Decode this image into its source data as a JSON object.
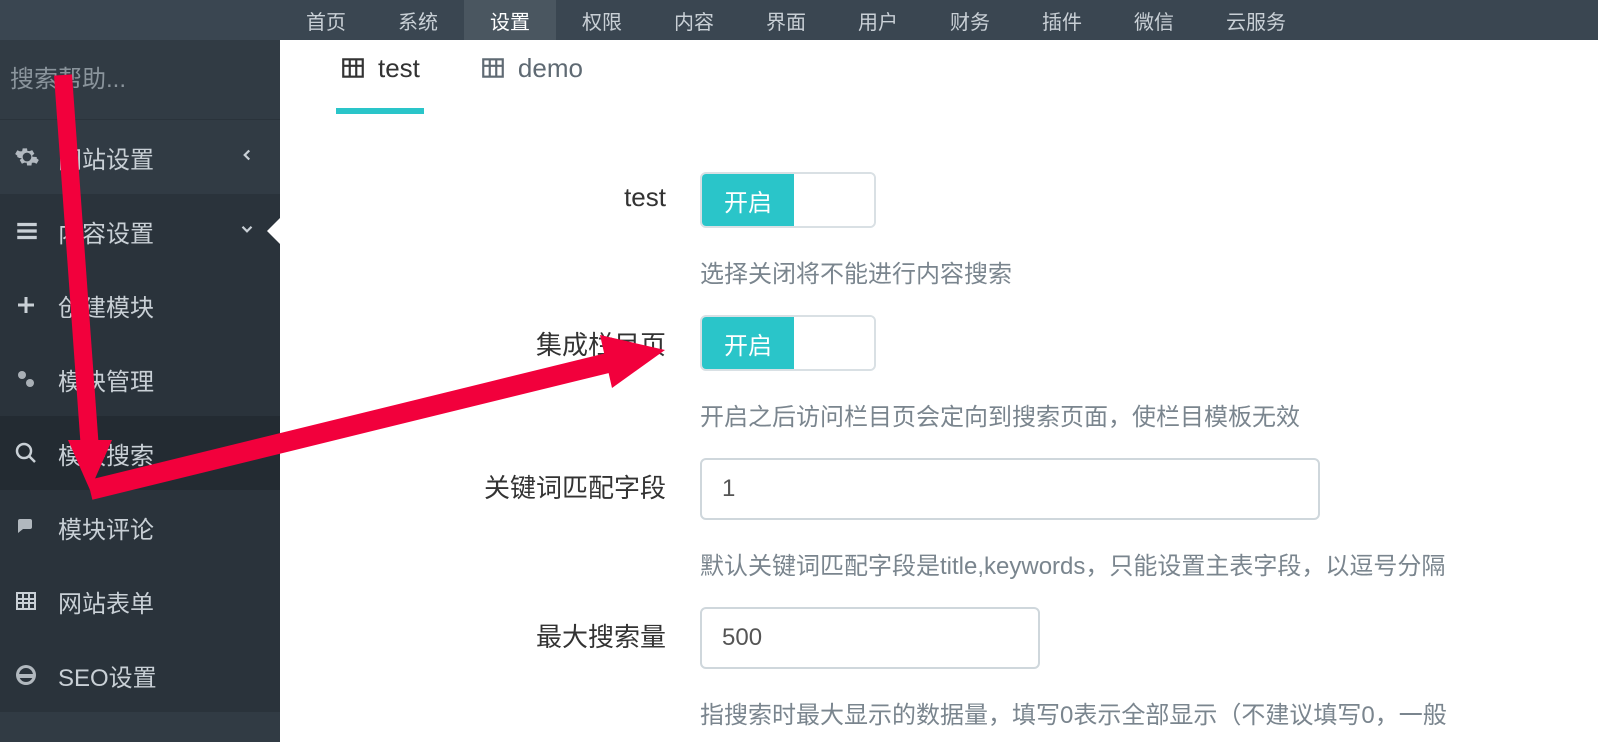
{
  "topnav": {
    "items": [
      "首页",
      "系统",
      "设置",
      "权限",
      "内容",
      "界面",
      "用户",
      "财务",
      "插件",
      "微信",
      "云服务"
    ],
    "activeIndex": 2
  },
  "sidebar": {
    "search_placeholder": "搜索帮助...",
    "items": [
      {
        "label": "网站设置"
      },
      {
        "label": "内容设置"
      }
    ],
    "subs": [
      {
        "label": "创建模块"
      },
      {
        "label": "模块管理"
      },
      {
        "label": "模块搜索"
      },
      {
        "label": "模块评论"
      },
      {
        "label": "网站表单"
      },
      {
        "label": "SEO设置"
      }
    ]
  },
  "tabs": {
    "items": [
      "test",
      "demo"
    ],
    "activeIndex": 0
  },
  "form": {
    "toggle_on_label": "开启",
    "row1": {
      "label": "test",
      "help": "选择关闭将不能进行内容搜索"
    },
    "row2": {
      "label": "集成栏目页",
      "help": "开启之后访问栏目页会定向到搜索页面，使栏目模板无效"
    },
    "row3": {
      "label": "关键词匹配字段",
      "value": "1",
      "help": "默认关键词匹配字段是title,keywords，只能设置主表字段，以逗号分隔"
    },
    "row4": {
      "label": "最大搜索量",
      "value": "500",
      "help": "指搜索时最大显示的数据量，填写0表示全部显示（不建议填写0，一般"
    }
  }
}
